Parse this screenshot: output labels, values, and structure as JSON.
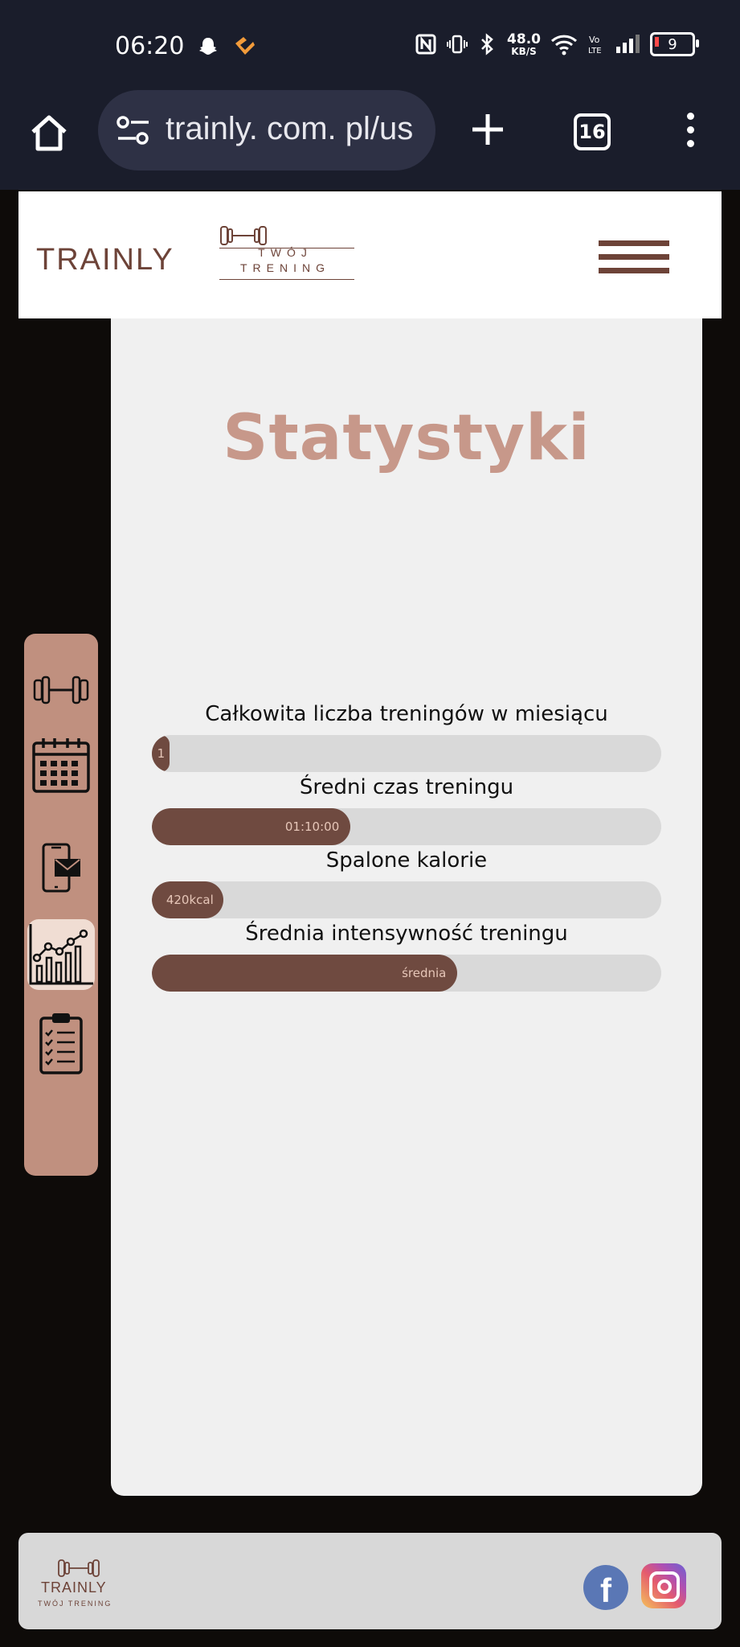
{
  "status_bar": {
    "time": "06:20",
    "speed_value": "48.0",
    "speed_unit": "KB/S",
    "battery": "9",
    "icons": [
      "snapchat-icon",
      "heart-app-icon",
      "nfc-icon",
      "vibrate-icon",
      "bluetooth-icon",
      "wifi-icon",
      "volte-icon",
      "signal-icon",
      "battery-icon"
    ]
  },
  "browser": {
    "url": "trainly. com. pl/us",
    "tab_count": "16"
  },
  "header": {
    "logo_word": "TRAINLY",
    "logo_tagline_1": "TWÓJ",
    "logo_tagline_2": "TRENING"
  },
  "main": {
    "title": "Statystyki",
    "stats": [
      {
        "label": "Całkowita liczba treningów w miesiącu",
        "value": "1",
        "fill_fraction": 0.03
      },
      {
        "label": "Średni czas treningu",
        "value": "01:10:00",
        "fill_fraction": 0.39
      },
      {
        "label": "Spalone kalorie",
        "value": "420kcal",
        "fill_fraction": 0.14
      },
      {
        "label": "Średnia intensywność treningu",
        "value": "średnia",
        "fill_fraction": 0.6
      }
    ]
  },
  "sidebar": {
    "items": [
      "dumbbell-icon",
      "calendar-icon",
      "phone-mail-icon",
      "chart-icon",
      "clipboard-icon"
    ],
    "active": "chart-icon"
  },
  "footer": {
    "logo_word": "TRAINLY",
    "logo_tagline": "TWÓJ TRENING",
    "social": [
      "facebook-icon",
      "instagram-icon"
    ],
    "facebook_letter": "f"
  },
  "colors": {
    "brand_brown": "#6d4338",
    "accent_rose": "#c7988a",
    "sidebar": "#c0907f",
    "bar_fill": "#6f4a40",
    "bar_track": "#d9d9d9"
  }
}
